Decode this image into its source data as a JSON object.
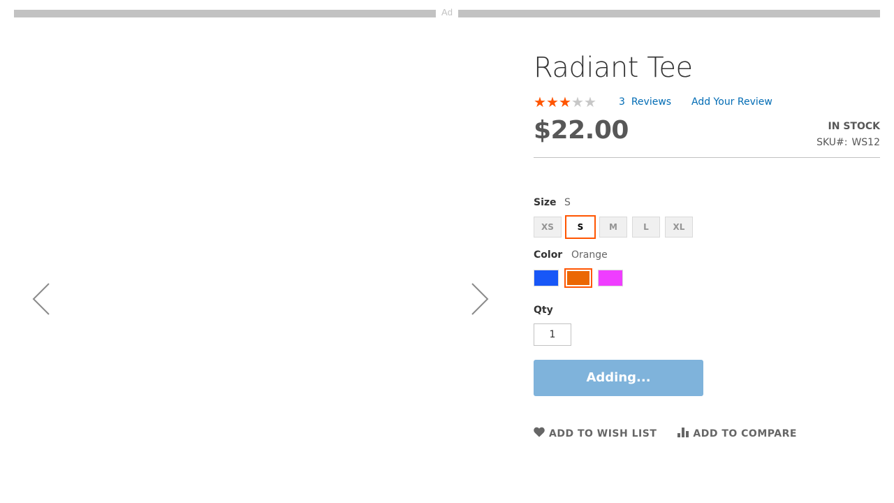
{
  "ad": {
    "label": "Ad"
  },
  "product": {
    "name": "Radiant Tee",
    "rating": {
      "value": 3,
      "max": 5
    },
    "reviews_count": "3",
    "reviews_label": "Reviews",
    "add_review_label": "Add Your Review",
    "price": "$22.00",
    "stock_status": "In stock",
    "sku_label": "SKU#:",
    "sku_value": "WS12"
  },
  "options": {
    "size": {
      "label": "Size",
      "selected": "S",
      "values": [
        "XS",
        "S",
        "M",
        "L",
        "XL"
      ]
    },
    "color": {
      "label": "Color",
      "selected": "Orange",
      "values": [
        {
          "name": "Blue",
          "hex": "#1857f7"
        },
        {
          "name": "Orange",
          "hex": "#eb6703"
        },
        {
          "name": "Purple",
          "hex": "#ef3dff"
        }
      ]
    }
  },
  "qty": {
    "label": "Qty",
    "value": "1"
  },
  "add_to_cart": {
    "label": "Adding..."
  },
  "actions": {
    "wishlist": "Add to Wish List",
    "compare": "Add to Compare"
  },
  "colors": {
    "accent": "#ff5501",
    "link": "#006bb4",
    "button": "#7fb3db"
  }
}
